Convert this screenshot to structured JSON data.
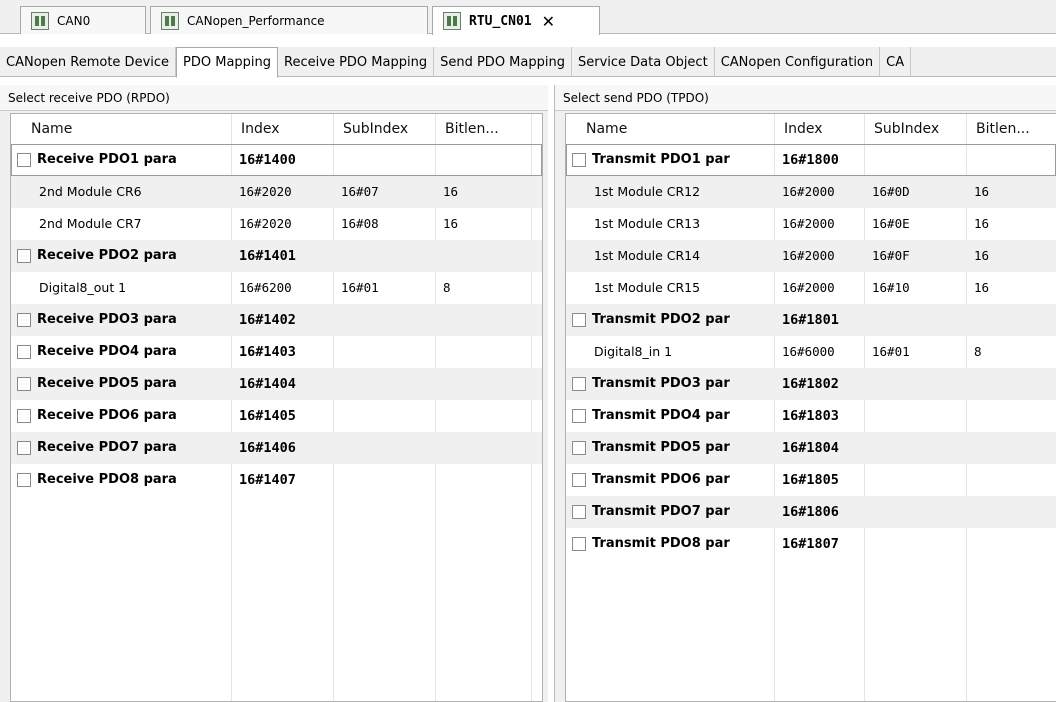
{
  "doc_tabs": [
    {
      "label": "CAN0",
      "active": false
    },
    {
      "label": "CANopen_Performance",
      "active": false
    },
    {
      "label": "RTU_CN01",
      "active": true,
      "close": "✕"
    }
  ],
  "editor_tabs": [
    "CANopen Remote Device",
    "PDO Mapping",
    "Receive PDO Mapping",
    "Send PDO Mapping",
    "Service Data Object",
    "CANopen Configuration",
    "CA"
  ],
  "active_editor_tab": "PDO Mapping",
  "rpdo": {
    "title": "Select receive PDO (RPDO)",
    "columns": [
      "Name",
      "Index",
      "SubIndex",
      "Bitlen..."
    ],
    "rows": [
      {
        "type": "group",
        "name": "Receive PDO1 para",
        "index": "16#1400",
        "sub": "",
        "bitlen": ""
      },
      {
        "type": "child",
        "name": "2nd Module CR6",
        "index": "16#2020",
        "sub": "16#07",
        "bitlen": "16"
      },
      {
        "type": "child",
        "name": "2nd Module CR7",
        "index": "16#2020",
        "sub": "16#08",
        "bitlen": "16"
      },
      {
        "type": "group",
        "name": "Receive PDO2 para",
        "index": "16#1401",
        "sub": "",
        "bitlen": ""
      },
      {
        "type": "child",
        "name": "Digital8_out 1",
        "index": "16#6200",
        "sub": "16#01",
        "bitlen": "8"
      },
      {
        "type": "group",
        "name": "Receive PDO3 para",
        "index": "16#1402",
        "sub": "",
        "bitlen": ""
      },
      {
        "type": "group",
        "name": "Receive PDO4 para",
        "index": "16#1403",
        "sub": "",
        "bitlen": ""
      },
      {
        "type": "group",
        "name": "Receive PDO5 para",
        "index": "16#1404",
        "sub": "",
        "bitlen": ""
      },
      {
        "type": "group",
        "name": "Receive PDO6 para",
        "index": "16#1405",
        "sub": "",
        "bitlen": ""
      },
      {
        "type": "group",
        "name": "Receive PDO7 para",
        "index": "16#1406",
        "sub": "",
        "bitlen": ""
      },
      {
        "type": "group",
        "name": "Receive PDO8 para",
        "index": "16#1407",
        "sub": "",
        "bitlen": ""
      }
    ]
  },
  "tpdo": {
    "title": "Select send PDO (TPDO)",
    "columns": [
      "Name",
      "Index",
      "SubIndex",
      "Bitlen..."
    ],
    "rows": [
      {
        "type": "group",
        "name": "Transmit PDO1 par",
        "index": "16#1800",
        "sub": "",
        "bitlen": ""
      },
      {
        "type": "child",
        "name": "1st Module CR12",
        "index": "16#2000",
        "sub": "16#0D",
        "bitlen": "16"
      },
      {
        "type": "child",
        "name": "1st Module CR13",
        "index": "16#2000",
        "sub": "16#0E",
        "bitlen": "16"
      },
      {
        "type": "child",
        "name": "1st Module CR14",
        "index": "16#2000",
        "sub": "16#0F",
        "bitlen": "16"
      },
      {
        "type": "child",
        "name": "1st Module CR15",
        "index": "16#2000",
        "sub": "16#10",
        "bitlen": "16"
      },
      {
        "type": "group",
        "name": "Transmit PDO2 par",
        "index": "16#1801",
        "sub": "",
        "bitlen": ""
      },
      {
        "type": "child",
        "name": "Digital8_in 1",
        "index": "16#6000",
        "sub": "16#01",
        "bitlen": "8"
      },
      {
        "type": "group",
        "name": "Transmit PDO3 par",
        "index": "16#1802",
        "sub": "",
        "bitlen": ""
      },
      {
        "type": "group",
        "name": "Transmit PDO4 par",
        "index": "16#1803",
        "sub": "",
        "bitlen": ""
      },
      {
        "type": "group",
        "name": "Transmit PDO5 par",
        "index": "16#1804",
        "sub": "",
        "bitlen": ""
      },
      {
        "type": "group",
        "name": "Transmit PDO6 par",
        "index": "16#1805",
        "sub": "",
        "bitlen": ""
      },
      {
        "type": "group",
        "name": "Transmit PDO7 par",
        "index": "16#1806",
        "sub": "",
        "bitlen": ""
      },
      {
        "type": "group",
        "name": "Transmit PDO8 par",
        "index": "16#1807",
        "sub": "",
        "bitlen": ""
      }
    ]
  }
}
